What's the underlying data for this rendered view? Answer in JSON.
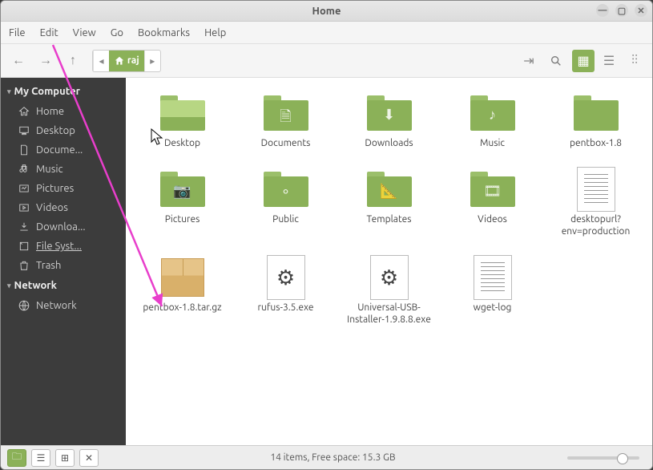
{
  "window": {
    "title": "Home"
  },
  "menubar": [
    "File",
    "Edit",
    "View",
    "Go",
    "Bookmarks",
    "Help"
  ],
  "path": {
    "current": "raj"
  },
  "sidebar": {
    "sections": [
      {
        "header": "My Computer",
        "items": [
          {
            "label": "Home",
            "icon": "home"
          },
          {
            "label": "Desktop",
            "icon": "desktop"
          },
          {
            "label": "Docume...",
            "icon": "document"
          },
          {
            "label": "Music",
            "icon": "music"
          },
          {
            "label": "Pictures",
            "icon": "pictures"
          },
          {
            "label": "Videos",
            "icon": "videos"
          },
          {
            "label": "Downloa...",
            "icon": "download"
          },
          {
            "label": "File Syst...",
            "icon": "disk",
            "selected": true
          },
          {
            "label": "Trash",
            "icon": "trash"
          }
        ]
      },
      {
        "header": "Network",
        "items": [
          {
            "label": "Network",
            "icon": "network"
          }
        ]
      }
    ]
  },
  "files": [
    {
      "label": "Desktop",
      "type": "folder",
      "glyph": "",
      "variant": "desktop"
    },
    {
      "label": "Documents",
      "type": "folder",
      "glyph": "🗎"
    },
    {
      "label": "Downloads",
      "type": "folder",
      "glyph": "⬇"
    },
    {
      "label": "Music",
      "type": "folder",
      "glyph": "♪"
    },
    {
      "label": "pentbox-1.8",
      "type": "folder",
      "glyph": ""
    },
    {
      "label": "Pictures",
      "type": "folder",
      "glyph": "📷"
    },
    {
      "label": "Public",
      "type": "folder",
      "glyph": "∘"
    },
    {
      "label": "Templates",
      "type": "folder",
      "glyph": "📐"
    },
    {
      "label": "Videos",
      "type": "folder",
      "glyph": "🎞"
    },
    {
      "label": "desktopurl?env=production",
      "type": "file",
      "variant": "text"
    },
    {
      "label": "pentbox-1.8.tar.gz",
      "type": "file",
      "variant": "archive"
    },
    {
      "label": "rufus-3.5.exe",
      "type": "file",
      "variant": "exe"
    },
    {
      "label": "Universal-USB-Installer-1.9.8.8.exe",
      "type": "file",
      "variant": "exe"
    },
    {
      "label": "wget-log",
      "type": "file",
      "variant": "text"
    }
  ],
  "status": "14 items, Free space: 15.3 GB"
}
